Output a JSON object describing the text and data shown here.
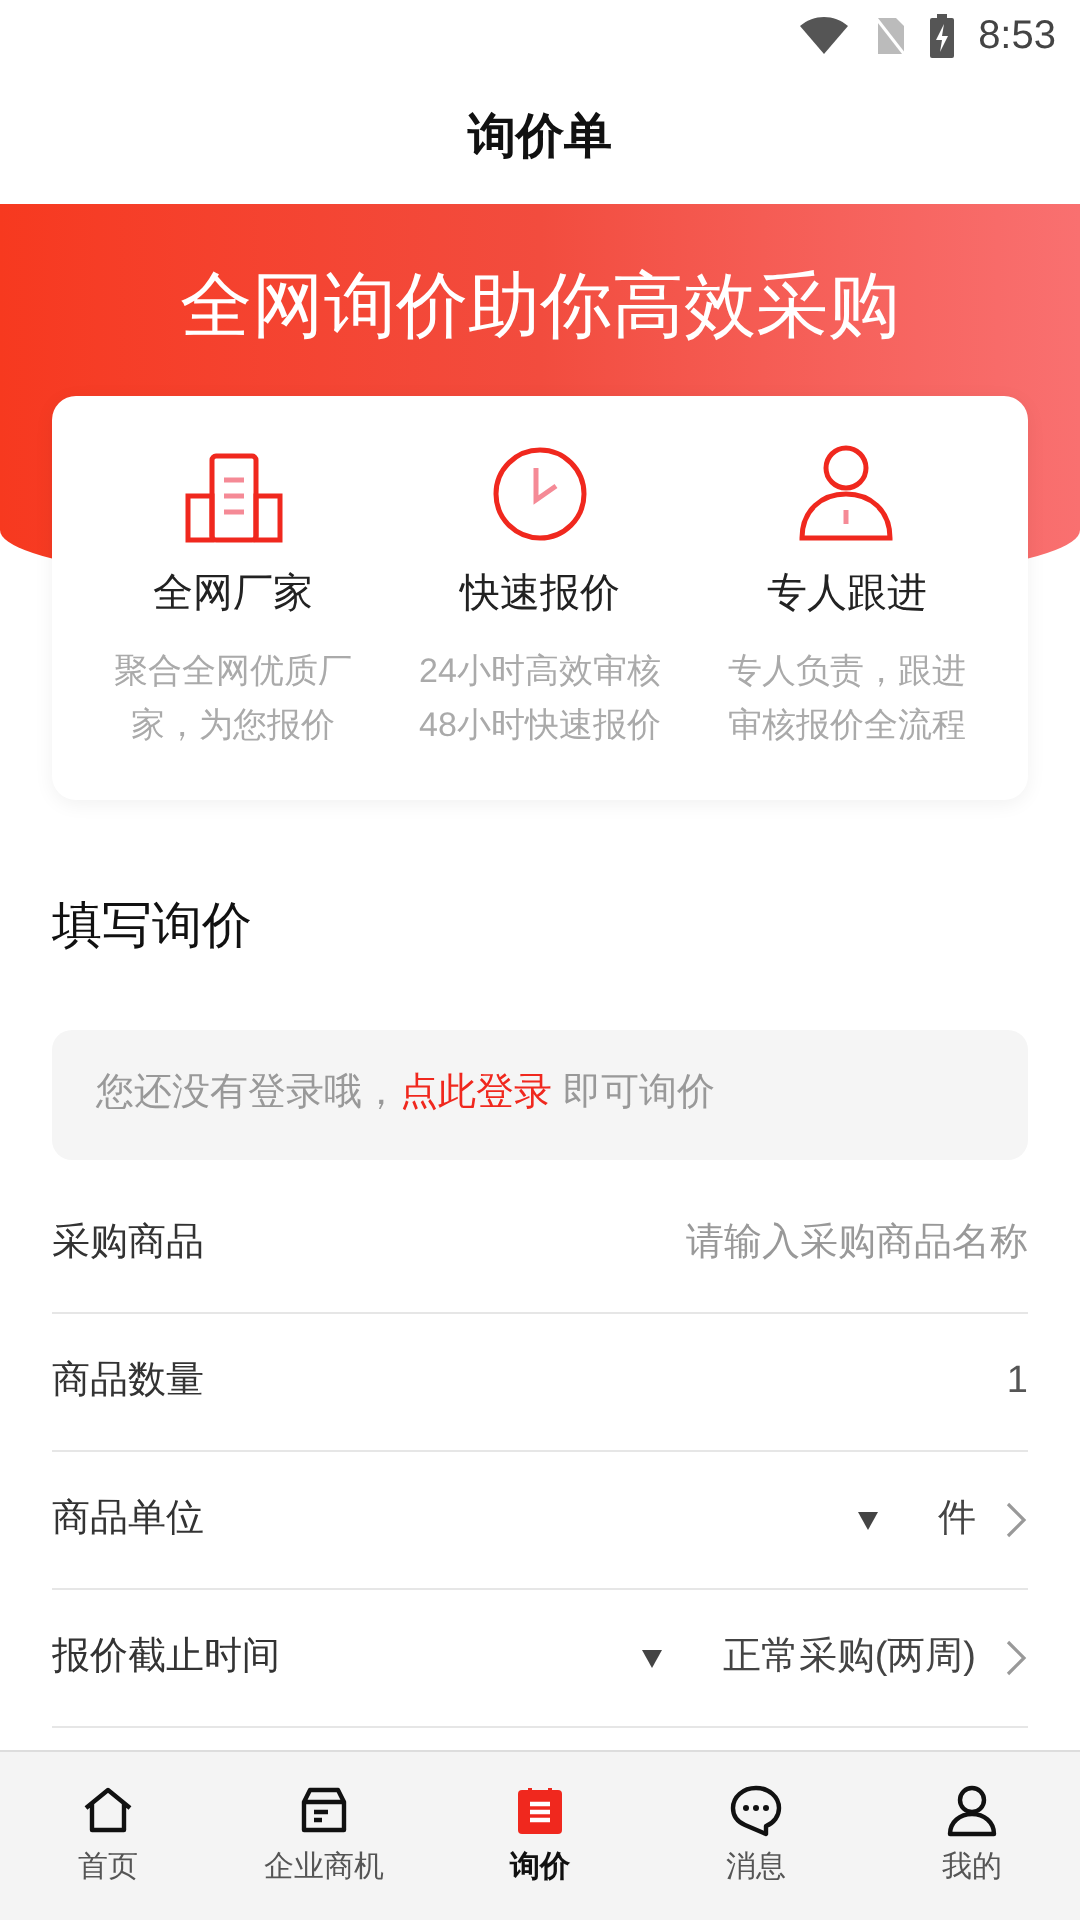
{
  "status_bar": {
    "time": "8:53"
  },
  "title": "询价单",
  "banner": {
    "headline": "全网询价助你高效采购"
  },
  "features": [
    {
      "kind": "factory",
      "title": "全网厂家",
      "desc_lines": [
        "聚合全网优质厂",
        "家，为您报价"
      ]
    },
    {
      "kind": "clock",
      "title": "快速报价",
      "desc_lines": [
        "24小时高效审核",
        "48小时快速报价"
      ]
    },
    {
      "kind": "person",
      "title": "专人跟进",
      "desc_lines": [
        "专人负责，跟进",
        "审核报价全流程"
      ]
    }
  ],
  "form": {
    "title": "填写询价",
    "login_notice": {
      "before": "您还没有登录哦，",
      "link": "点此登录",
      "after": " 即可询价"
    },
    "rows": [
      {
        "kind": "input",
        "label": "采购商品",
        "placeholder": "请输入采购商品名称"
      },
      {
        "kind": "value",
        "label": "商品数量",
        "value": "1"
      },
      {
        "kind": "select",
        "label": "商品单位",
        "value": "件"
      },
      {
        "kind": "select",
        "label": "报价截止时间",
        "value": "正常采购(两周)"
      }
    ]
  },
  "tabs": [
    {
      "kind": "home",
      "label": "首页",
      "selected": false
    },
    {
      "kind": "box",
      "label": "企业商机",
      "selected": false
    },
    {
      "kind": "clipboard",
      "label": "询价",
      "selected": true
    },
    {
      "kind": "chat",
      "label": "消息",
      "selected": false
    },
    {
      "kind": "person",
      "label": "我的",
      "selected": false
    }
  ]
}
